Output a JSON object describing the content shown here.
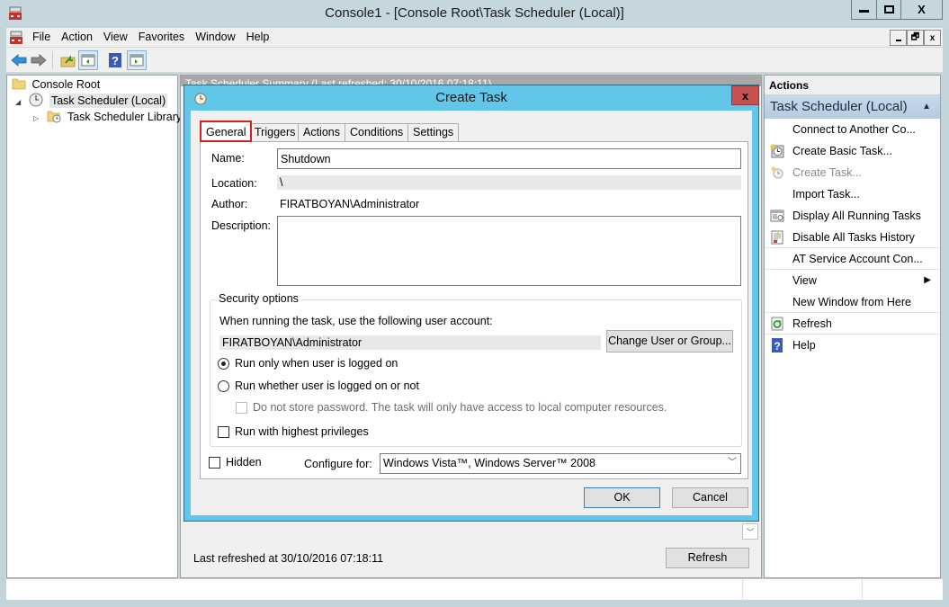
{
  "window": {
    "title": "Console1 - [Console Root\\Task Scheduler (Local)]",
    "controls": {
      "minimize": "—",
      "maximize": "☐",
      "close": "X"
    }
  },
  "menubar": {
    "items": [
      "File",
      "Action",
      "View",
      "Favorites",
      "Window",
      "Help"
    ],
    "mdi_controls": {
      "minimize": "_",
      "restore": "🗗",
      "close": "x"
    }
  },
  "toolbar": {
    "buttons": [
      "back-icon",
      "forward-icon",
      "up-folder-icon",
      "show-hide-console-tree-icon",
      "help-icon",
      "show-hide-action-pane-icon"
    ]
  },
  "tree": {
    "items": [
      {
        "label": "Console Root",
        "icon": "folder-icon",
        "level": 0
      },
      {
        "label": "Task Scheduler (Local)",
        "icon": "clock-icon",
        "level": 1,
        "expanded": true,
        "selected": true
      },
      {
        "label": "Task Scheduler Library",
        "icon": "folder-clock-icon",
        "level": 2,
        "expanded": false
      }
    ]
  },
  "center": {
    "summary_header": "Task Scheduler Summary (Last refreshed: 30/10/2016 07:18:11)",
    "last_refreshed": "Last refreshed at 30/10/2016 07:18:11",
    "refresh_label": "Refresh"
  },
  "dialog": {
    "title": "Create Task",
    "close": "x",
    "tabs": [
      "General",
      "Triggers",
      "Actions",
      "Conditions",
      "Settings"
    ],
    "active_tab": "General",
    "general": {
      "name_label": "Name:",
      "name_value": "Shutdown",
      "location_label": "Location:",
      "location_value": "\\",
      "author_label": "Author:",
      "author_value": "FIRATBOYAN\\Administrator",
      "description_label": "Description:",
      "description_value": "",
      "security": {
        "legend": "Security options",
        "account_prompt": "When running the task, use the following user account:",
        "account_value": "FIRATBOYAN\\Administrator",
        "change_button": "Change User or Group...",
        "radio_logged_on": "Run only when user is logged on",
        "radio_logged_on_checked": true,
        "radio_whether": "Run whether user is logged on or not",
        "radio_whether_checked": false,
        "no_store_password": "Do not store password.  The task will only have access to local computer resources.",
        "no_store_password_checked": false,
        "highest_privileges": "Run with highest privileges",
        "highest_privileges_checked": false
      },
      "hidden_label": "Hidden",
      "hidden_checked": false,
      "configure_label": "Configure for:",
      "configure_value": "Windows Vista™, Windows Server™ 2008"
    },
    "ok_label": "OK",
    "cancel_label": "Cancel"
  },
  "actions_pane": {
    "title": "Actions",
    "group": "Task Scheduler (Local)",
    "items": [
      {
        "label": "Connect to Another Co...",
        "icon": ""
      },
      {
        "label": "Create Basic Task...",
        "icon": "create-basic-task-icon"
      },
      {
        "label": "Create Task...",
        "icon": "create-task-icon",
        "disabled": true
      },
      {
        "label": "Import Task...",
        "icon": ""
      },
      {
        "label": "Display All Running Tasks",
        "icon": "running-tasks-icon"
      },
      {
        "label": "Disable All Tasks History",
        "icon": "history-icon"
      },
      {
        "label": "AT Service Account Con...",
        "icon": ""
      },
      {
        "label": "View",
        "icon": "",
        "submenu": true
      },
      {
        "label": "New Window from Here",
        "icon": ""
      },
      {
        "label": "Refresh",
        "icon": "refresh-icon"
      },
      {
        "label": "Help",
        "icon": "help-icon"
      }
    ]
  },
  "colors": {
    "dialog_frame": "#62c6e8",
    "close_button": "#c75050",
    "active_tab_highlight": "#d42020",
    "actions_group": "#b5cbe0"
  }
}
